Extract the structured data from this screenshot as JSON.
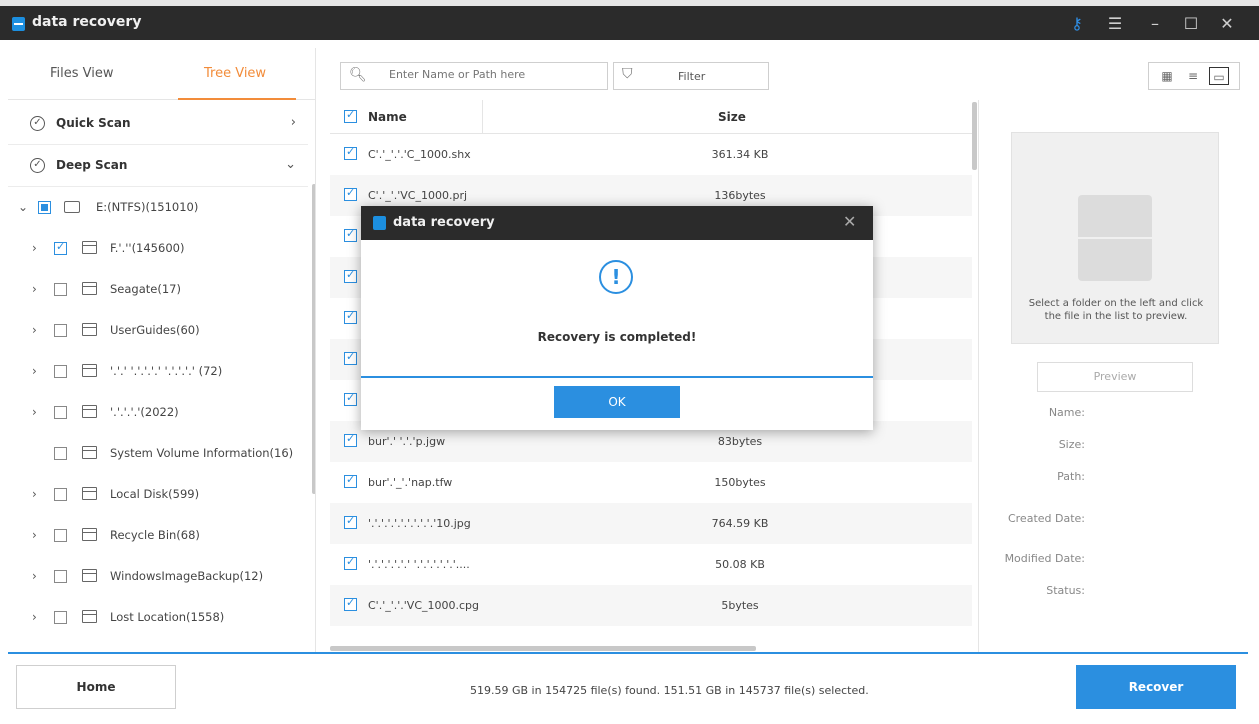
{
  "window": {
    "title": "data recovery",
    "controls": [
      "key-icon",
      "menu-icon",
      "minimize-icon",
      "maximize-icon",
      "close-icon"
    ]
  },
  "left_panel": {
    "tabs": [
      "Files View",
      "Tree View"
    ],
    "active_tab": "Tree View",
    "scans": [
      "Quick Scan",
      "Deep Scan"
    ],
    "tree": [
      {
        "label": "E:(NTFS)(151010)",
        "checked": "partial",
        "expanded": true
      },
      {
        "label": "F.'.''(145600)",
        "checked": true
      },
      {
        "label": "Seagate(17)",
        "checked": false
      },
      {
        "label": "UserGuides(60)",
        "checked": false
      },
      {
        "label": "'.'.' '.'.'.'.' '.'.'.'.' (72)",
        "checked": false
      },
      {
        "label": "'.'.'.'.'(2022)",
        "checked": false
      },
      {
        "label": "System Volume Information(16)",
        "checked": false
      },
      {
        "label": "Local Disk(599)",
        "checked": false
      },
      {
        "label": "Recycle Bin(68)",
        "checked": false
      },
      {
        "label": "WindowsImageBackup(12)",
        "checked": false
      },
      {
        "label": "Lost Location(1558)",
        "checked": false
      }
    ]
  },
  "toolbar": {
    "search_placeholder": "Enter Name or Path here",
    "filter_label": "Filter",
    "view_modes": [
      "grid-view-icon",
      "list-view-icon",
      "preview-view-icon"
    ]
  },
  "file_list": {
    "columns": [
      "Name",
      "Size"
    ],
    "rows": [
      {
        "name": "C'.'_'.'.'C_1000.shx",
        "size": "361.34 KB"
      },
      {
        "name": "C'.'_'.'VC_1000.prj",
        "size": "136bytes"
      },
      {
        "name": "",
        "size": ""
      },
      {
        "name": "",
        "size": ""
      },
      {
        "name": "",
        "size": ""
      },
      {
        "name": "",
        "size": ""
      },
      {
        "name": "",
        "size": ""
      },
      {
        "name": "bur'.' '.'.'p.jgw",
        "size": "83bytes"
      },
      {
        "name": "bur'.'_'.'nap.tfw",
        "size": "150bytes"
      },
      {
        "name": "'.'.'.'.'.'.'.'.'.'.'10.jpg",
        "size": "764.59 KB"
      },
      {
        "name": "'.'.'.'.'.'.' '.'.'.'.'.'.'....",
        "size": "50.08 KB"
      },
      {
        "name": "C'.'_'.'.'VC_1000.cpg",
        "size": "5bytes"
      }
    ]
  },
  "preview": {
    "hint": "Select a folder on the left and click the file in the list to preview.",
    "button": "Preview",
    "fields": [
      "Name:",
      "Size:",
      "Path:",
      "Created Date:",
      "Modified Date:",
      "Status:"
    ]
  },
  "bottom": {
    "home": "Home",
    "status": "519.59 GB in 154725 file(s) found.  151.51 GB in 145737 file(s) selected.",
    "recover": "Recover"
  },
  "dialog": {
    "title": "data recovery",
    "message": "Recovery is completed!",
    "ok": "OK"
  },
  "colors": {
    "accent": "#2b8fe0",
    "tab_active": "#f28c3a",
    "titlebar": "#2b2b2b"
  }
}
